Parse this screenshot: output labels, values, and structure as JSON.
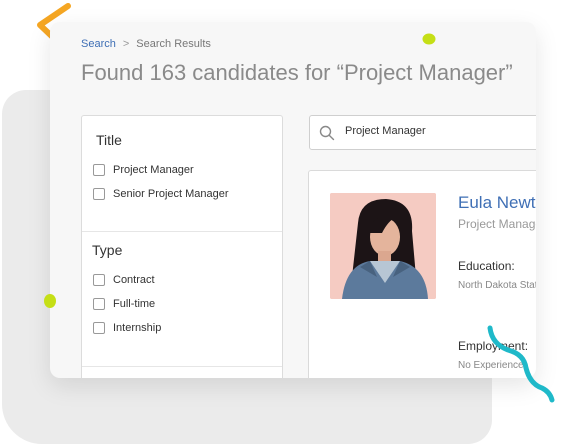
{
  "breadcrumb": {
    "root": "Search",
    "separator": ">",
    "current": "Search Results"
  },
  "page_title": "Found 163 candidates for “Project Manager”",
  "filters": {
    "sections": [
      {
        "heading": "Title",
        "options": [
          "Project Manager",
          "Senior Project Manager"
        ]
      },
      {
        "heading": "Type",
        "options": [
          "Contract",
          "Full-time",
          "Internship"
        ]
      }
    ]
  },
  "search": {
    "value": "Project Manager",
    "icon": "search-icon"
  },
  "candidate": {
    "name": "Eula Newton",
    "role": "Project Manager",
    "education_label": "Education:",
    "education_value": "North Dakota State University",
    "employment_label": "Employment:",
    "employment_value": "No Experience"
  },
  "colors": {
    "accent_blue": "#3f6fb5",
    "orange": "#f5a623",
    "lime": "#c5df16",
    "teal": "#1fb9c9"
  }
}
